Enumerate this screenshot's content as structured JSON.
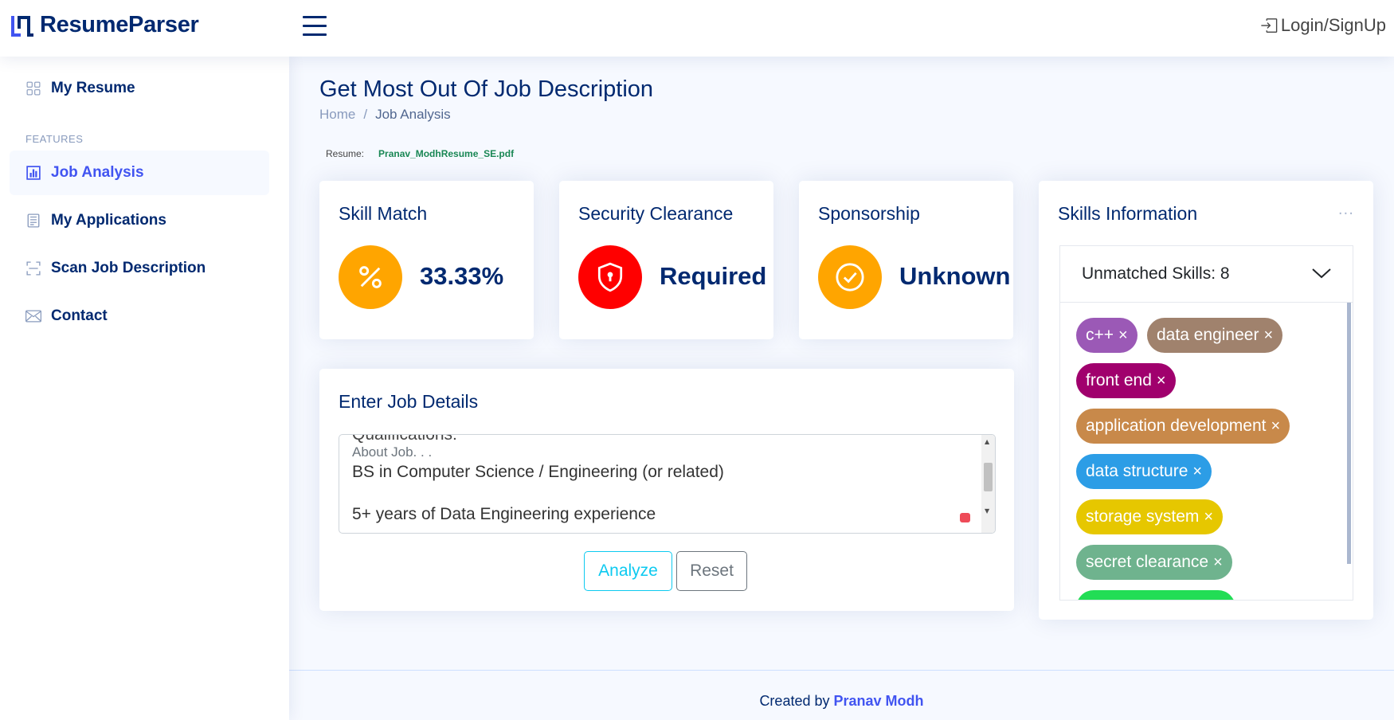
{
  "header": {
    "brand": "ResumeParser",
    "login_label": "Login/SignUp",
    "icons": {
      "menu": "hamburger-icon",
      "login": "box-arrow-in-right-icon"
    }
  },
  "sidebar": {
    "items_top": [
      {
        "label": "My Resume",
        "icon": "grid-icon"
      }
    ],
    "heading": "FEATURES",
    "items": [
      {
        "label": "Job Analysis",
        "icon": "bar-chart-icon",
        "active": true
      },
      {
        "label": "My Applications",
        "icon": "layout-text-icon"
      },
      {
        "label": "Scan Job Description",
        "icon": "scan-icon"
      },
      {
        "label": "Contact",
        "icon": "envelope-icon"
      }
    ]
  },
  "page": {
    "title": "Get Most Out Of Job Description",
    "breadcrumb": [
      "Home",
      "Job Analysis"
    ],
    "breadcrumb_sep": "/",
    "resume_label": "Resume:",
    "resume_file": "Pranav_ModhResume_SE.pdf"
  },
  "stats": [
    {
      "title": "Skill Match",
      "value": "33.33%",
      "color": "#ffa500",
      "icon": "percent-icon"
    },
    {
      "title": "Security Clearance",
      "value": "Required",
      "color": "#ff0000",
      "icon": "shield-lock-icon"
    },
    {
      "title": "Sponsorship",
      "value": "Unknown",
      "color": "#ffa500",
      "icon": "check-circle-icon"
    }
  ],
  "job_details": {
    "title": "Enter Job Details",
    "cut_line": "Qualifications:",
    "placeholder": "About Job. . .",
    "lines": [
      "BS in Computer Science / Engineering (or related)",
      "",
      "5+ years of Data Engineering experience"
    ],
    "analyze_label": "Analyze",
    "reset_label": "Reset"
  },
  "skills": {
    "title": "Skills Information",
    "menu": "...",
    "accordion_label": "Unmatched Skills: 8",
    "close_glyph": "×",
    "tags": [
      {
        "label": "c++",
        "color": "#9b59b6"
      },
      {
        "label": "data engineer",
        "color": "#a0826d"
      },
      {
        "label": "front end",
        "color": "#a0006d"
      },
      {
        "label": "application development",
        "color": "#c8894a"
      },
      {
        "label": "data structure",
        "color": "#2c9de6"
      },
      {
        "label": "storage system",
        "color": "#e6c700"
      },
      {
        "label": "secret clearance",
        "color": "#6fb38e"
      },
      {
        "label": "",
        "color": "#22dd55"
      }
    ]
  },
  "footer": {
    "prefix": "Created by",
    "author": "Pranav Modh"
  }
}
